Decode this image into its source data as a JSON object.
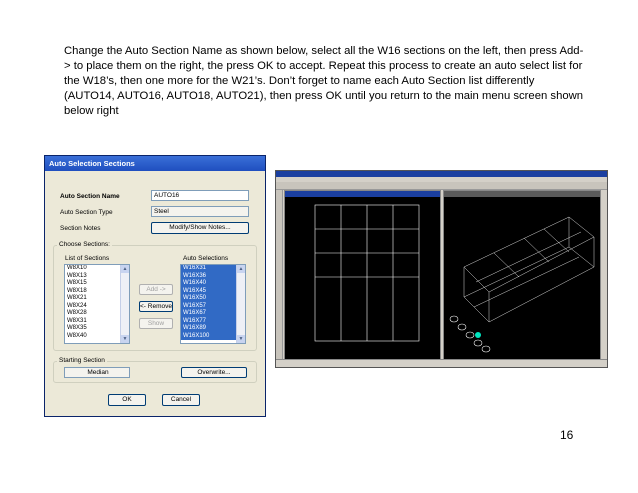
{
  "instructions": "Change the Auto Section Name as shown below, select all the W16 sections on the left, then press Add-> to place them on the right, the press OK to accept. Repeat this process to create an auto select list for the W18’s, then one more for the W21’s. Don’t forget to name each Auto Section list differently (AUTO14, AUTO16, AUTO18, AUTO21), then press OK until you return to the main menu screen shown below right",
  "page_number": "16",
  "dialog": {
    "title": "Auto Selection Sections",
    "auto_section_name_label": "Auto Section Name",
    "auto_section_name_value": "AUTO16",
    "auto_section_type_label": "Auto Section Type",
    "auto_section_type_value": "Steel",
    "section_notes_label": "Section Notes",
    "modify_notes_button": "Modify/Show Notes...",
    "choose_sections_label": "Choose Sections:",
    "list_of_sections_label": "List of Sections",
    "auto_selections_label": "Auto Selections",
    "list_of_sections": [
      "W8X10",
      "W8X13",
      "W8X15",
      "W8X18",
      "W8X21",
      "W8X24",
      "W8X28",
      "W8X31",
      "W8X35",
      "W8X40"
    ],
    "auto_selections": [
      "W16X31",
      "W16X36",
      "W16X40",
      "W16X45",
      "W16X50",
      "W16X57",
      "W16X67",
      "W16X77",
      "W16X89",
      "W16X100"
    ],
    "add_button": "Add ->",
    "remove_button": "<- Remove",
    "show_button": "Show",
    "starting_section_label": "Starting Section",
    "starting_section_value": "Median",
    "overwrite_button": "Overwrite...",
    "ok_button": "OK",
    "cancel_button": "Cancel"
  },
  "sap_window": {
    "colors": {
      "grid": "#ffffff",
      "background": "#000000",
      "highlight": "#00e5c0"
    }
  }
}
